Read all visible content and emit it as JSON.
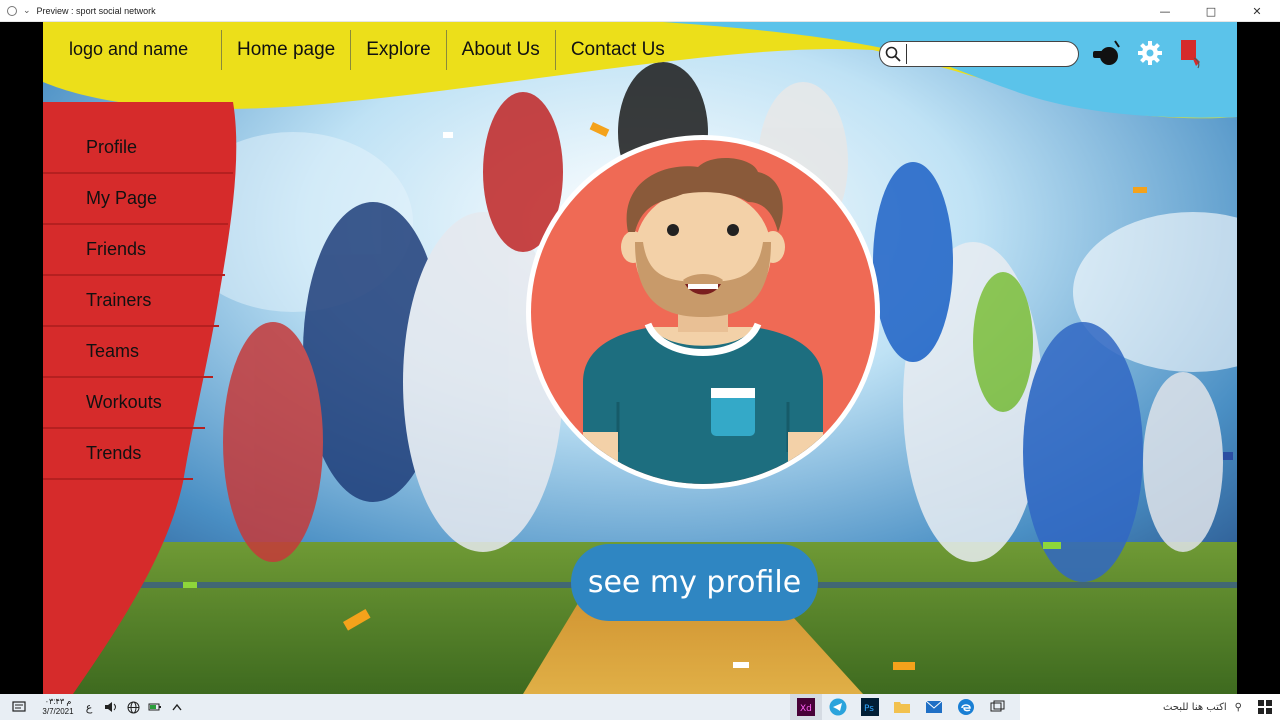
{
  "window": {
    "title": "Preview : sport social network",
    "minimize": "—",
    "maximize": "□",
    "close": "✕"
  },
  "header": {
    "logo": "logo and name",
    "nav": [
      "Home page",
      "Explore",
      "About Us",
      "Contact Us"
    ],
    "search_placeholder": "",
    "icons": [
      "search-icon",
      "whistle-icon",
      "gear-icon",
      "logout-icon"
    ]
  },
  "sidebar": {
    "items": [
      {
        "label": "Profile"
      },
      {
        "label": "My Page"
      },
      {
        "label": "Friends"
      },
      {
        "label": "Trainers"
      },
      {
        "label": "Teams"
      },
      {
        "label": "Workouts"
      },
      {
        "label": "Trends"
      }
    ]
  },
  "main": {
    "cta": "see my profile"
  },
  "taskbar": {
    "time": "۰۳:۴۳ م",
    "date": "3/7/2021",
    "lang": "ع",
    "search_placeholder": "اكتب هنا للبحث",
    "apps": [
      "xd-icon",
      "telegram-icon",
      "photoshop-icon",
      "folder-icon",
      "mail-icon",
      "edge-icon",
      "taskview-icon"
    ]
  },
  "colors": {
    "header_yellow": "#ecdf1a",
    "header_blue": "#5bc3ea",
    "sidebar_red": "#d62b2b",
    "cta_blue": "#2f86c2",
    "avatar_bg": "#ef6a55"
  }
}
